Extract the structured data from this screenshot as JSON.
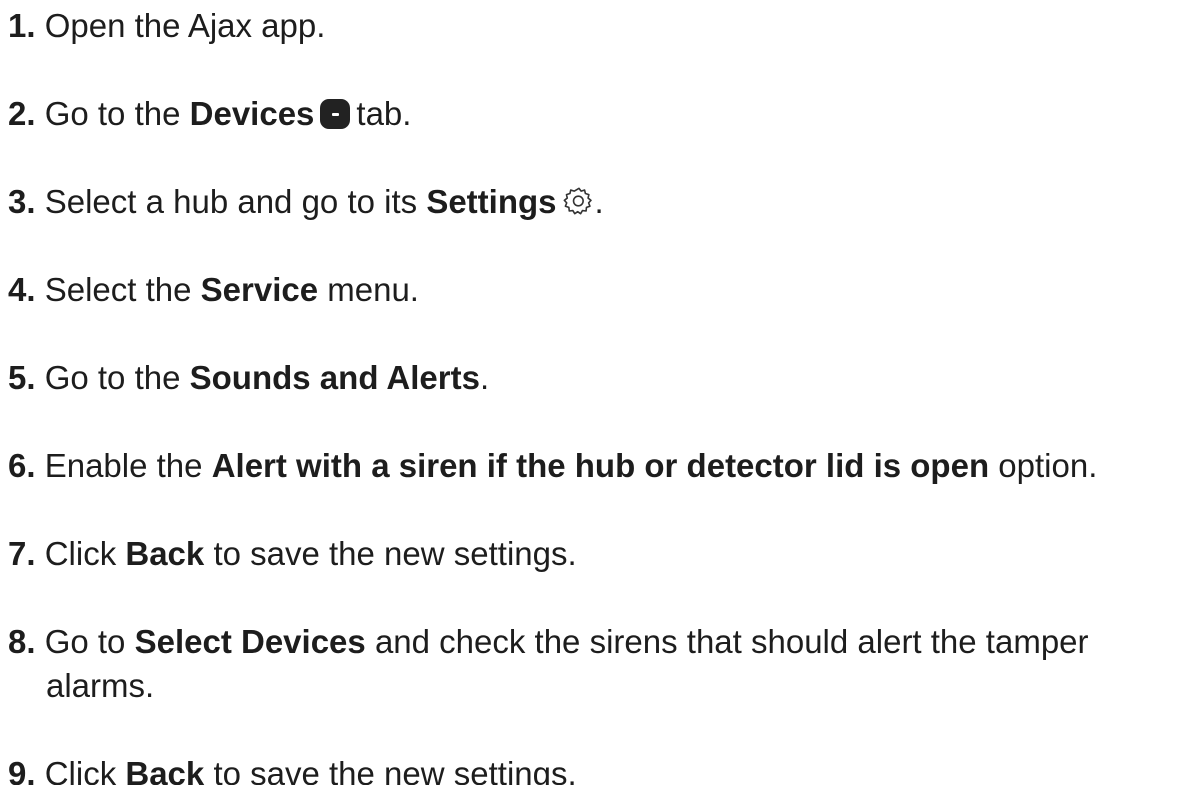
{
  "steps": [
    {
      "num": "1.",
      "pre": "Open the Ajax app."
    },
    {
      "num": "2.",
      "pre": "Go to the",
      "bold": "Devices",
      "post": "tab."
    },
    {
      "num": "3.",
      "pre": "Select a hub and go to its",
      "bold": "Settings",
      "post": "."
    },
    {
      "num": "4.",
      "pre": "Select the",
      "bold": "Service",
      "post": "menu."
    },
    {
      "num": "5.",
      "pre": "Go to the",
      "bold": "Sounds and Alerts",
      "post": "."
    },
    {
      "num": "6.",
      "pre": "Enable the",
      "bold": "Alert with a siren if the hub or detector lid is open",
      "post": "option."
    },
    {
      "num": "7.",
      "pre": "Click",
      "bold": "Back",
      "post": "to save the new settings."
    },
    {
      "num": "8.",
      "pre": "Go to",
      "bold": "Select Devices",
      "post": "and check the sirens that should alert the tamper",
      "cont": "alarms."
    },
    {
      "num": "9.",
      "pre": "Click",
      "bold": "Back",
      "post": "to save the new settings."
    }
  ],
  "icons": {
    "devices_tab": "devices-tab-icon",
    "settings": "gear-icon"
  }
}
